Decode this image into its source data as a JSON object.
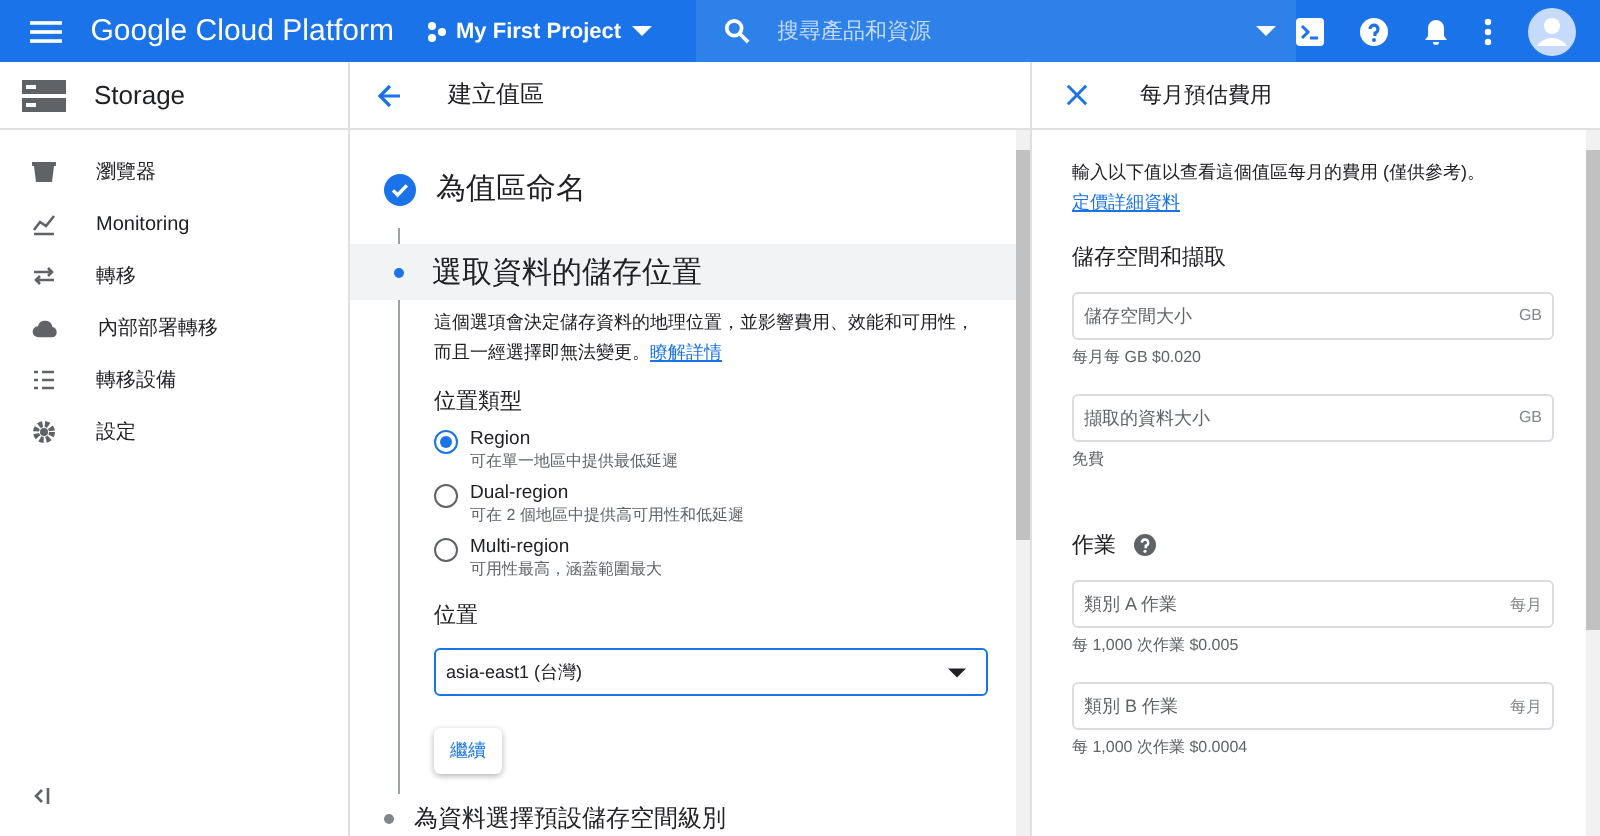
{
  "topbar": {
    "product": "Google Cloud Platform",
    "project": "My First Project",
    "search": {
      "placeholder": "搜尋產品和資源"
    }
  },
  "sidebar": {
    "title": "Storage",
    "items": [
      {
        "label": "瀏覽器",
        "kind": "bucket"
      },
      {
        "label": "Monitoring",
        "kind": "chart"
      },
      {
        "label": "轉移",
        "kind": "transfer"
      },
      {
        "label": "內部部署轉移",
        "kind": "cloud"
      },
      {
        "label": "轉移設備",
        "kind": "list"
      },
      {
        "label": "設定",
        "kind": "gear"
      }
    ]
  },
  "create": {
    "title": "建立值區",
    "steps": [
      {
        "kind": "done",
        "title": "為值區命名"
      },
      {
        "kind": "current",
        "title": "選取資料的儲存位置",
        "description": "這個選項會決定儲存資料的地理位置，並影響費用、效能和可用性，而且一經選擇即無法變更。",
        "link": "瞭解詳情",
        "type_label": "位置類型",
        "options": [
          {
            "label": "Region",
            "hint": "可在單一地區中提供最低延遲",
            "selected": true
          },
          {
            "label": "Dual-region",
            "hint": "可在 2 個地區中提供高可用性和低延遲",
            "selected": false
          },
          {
            "label": "Multi-region",
            "hint": "可用性最高，涵蓋範圍最大",
            "selected": false
          }
        ],
        "location_label": "位置",
        "location": "asia-east1 (台灣)",
        "continue": "繼續"
      },
      {
        "kind": "pending",
        "title": "為資料選擇預設儲存空間級別"
      }
    ]
  },
  "estimate": {
    "title": "每月預估費用",
    "intro": "輸入以下值以查看這個值區每月的費用 (僅供參考)。",
    "link": "定價詳細資料",
    "sections": [
      {
        "kind": "storage",
        "heading": "儲存空間和擷取",
        "fields": [
          {
            "placeholder": "儲存空間大小",
            "suffix": "GB",
            "hint": "每月每 GB $0.020"
          },
          {
            "placeholder": "擷取的資料大小",
            "suffix": "GB",
            "hint": "免費"
          }
        ]
      },
      {
        "kind": "operations",
        "heading": "作業",
        "fields": [
          {
            "placeholder": "類別 A 作業",
            "suffix": "每月",
            "hint": "每 1,000 次作業 $0.005"
          },
          {
            "placeholder": "類別 B 作業",
            "suffix": "每月",
            "hint": "每 1,000 次作業 $0.0004"
          }
        ]
      }
    ]
  }
}
